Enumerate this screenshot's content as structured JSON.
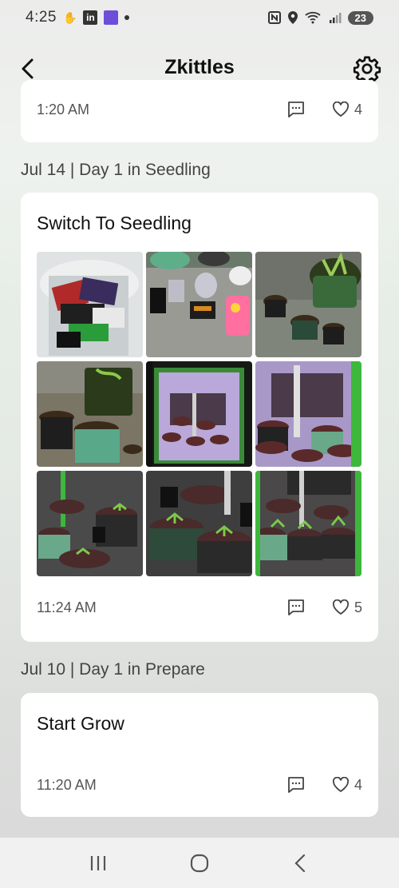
{
  "status_bar": {
    "time": "4:25",
    "icons": [
      "hand-icon",
      "linkedin-icon",
      "chart-app-icon",
      "dot-icon"
    ],
    "right_icons": [
      "nfc-icon",
      "location-icon",
      "wifi-5g-icon",
      "signal-icon"
    ],
    "battery": "23"
  },
  "app_bar": {
    "title": "Zkittles"
  },
  "prev_card": {
    "time": "1:20 AM",
    "likes": "4"
  },
  "sections": [
    {
      "header": "Jul 14 | Day 1 in Seedling",
      "post": {
        "title": "Switch To Seedling",
        "time": "11:24 AM",
        "likes": "5",
        "photos": [
          "seed-packets-bucket",
          "seeds-supplies-table",
          "potted-plants-outdoor",
          "pots-outdoor-tent",
          "grow-tent-purple-light",
          "pots-in-tent-purple",
          "seedlings-in-tent-1",
          "seedlings-in-tent-2",
          "seedlings-in-tent-3"
        ]
      }
    },
    {
      "header": "Jul 10 | Day 1 in Prepare",
      "post": {
        "title": "Start Grow",
        "time": "11:20 AM",
        "likes": "4"
      }
    }
  ],
  "colors": {
    "accent_green": "#3db83d",
    "grow_purple": "#b8a8d8",
    "card_bg": "#ffffff"
  }
}
